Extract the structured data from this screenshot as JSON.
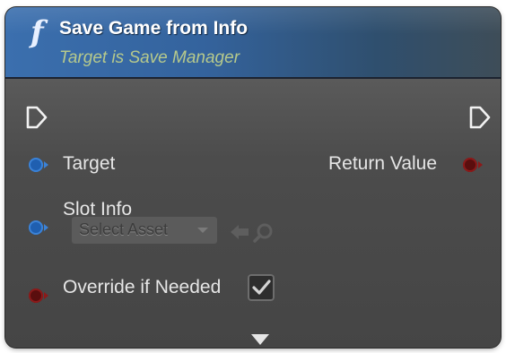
{
  "node": {
    "icon": "function-icon",
    "icon_glyph": "f",
    "title": "Save Game from Info",
    "subtitle": "Target is Save Manager",
    "header_color": "#3b6fae",
    "subtitle_color": "#b6c98c"
  },
  "pins": {
    "exec_in": {
      "icon": "exec-pin-icon"
    },
    "exec_out": {
      "icon": "exec-pin-icon"
    },
    "target": {
      "label": "Target",
      "type_color": "#1f5fb0"
    },
    "return_value": {
      "label": "Return Value",
      "type_color": "#8c1a1a"
    },
    "slot_info": {
      "label": "Slot Info",
      "type_color": "#1f5fb0",
      "asset_picker": {
        "value": "Select Asset",
        "icons": [
          "use-selected-arrow-icon",
          "browse-search-icon"
        ]
      }
    },
    "override_if_needed": {
      "label": "Override if Needed",
      "type_color": "#5a0e0e",
      "checked": true
    }
  },
  "footer": {
    "expand_icon": "expand-advanced-arrow-icon"
  }
}
